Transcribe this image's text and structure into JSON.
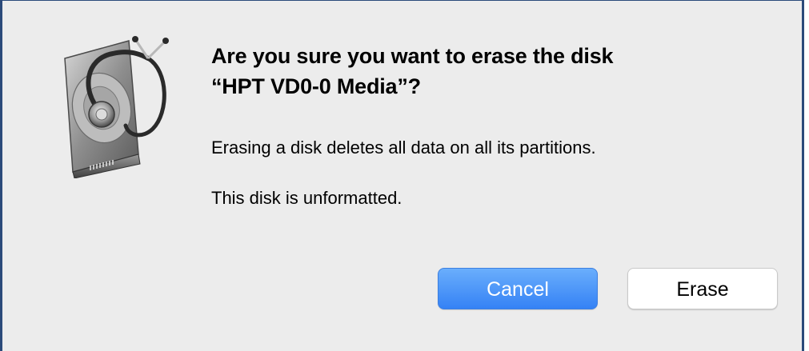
{
  "dialog": {
    "title_line1": "Are you sure you want to erase the disk",
    "title_line2": "“HPT VD0-0 Media”?",
    "message1": "Erasing a disk deletes all data on all its partitions.",
    "message2": "This disk is unformatted.",
    "icon": "disk-utility-icon"
  },
  "buttons": {
    "cancel_label": "Cancel",
    "erase_label": "Erase"
  },
  "colors": {
    "dialog_background": "#ececec",
    "window_border": "#2b4a7a",
    "default_button": "#3582f5"
  }
}
